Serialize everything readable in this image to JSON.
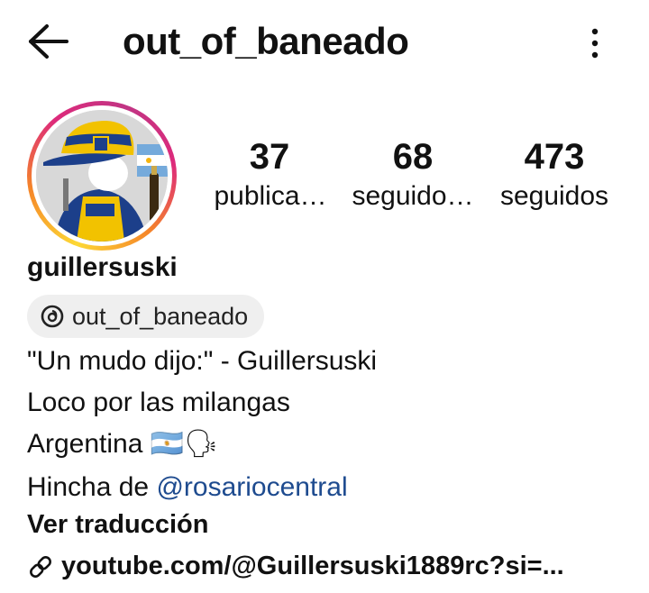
{
  "header": {
    "title": "out_of_baneado"
  },
  "stats": [
    {
      "value": "37",
      "label": "publica…"
    },
    {
      "value": "68",
      "label": "seguido…"
    },
    {
      "value": "473",
      "label": "seguidos"
    }
  ],
  "profile": {
    "username": "guillersuski",
    "threads_handle": "out_of_baneado",
    "bio_line1": "\"Un mudo dijo:\" - Guillersuski",
    "bio_line2": "Loco por las milangas",
    "bio_line3": "Argentina 🇦🇷🗣",
    "bio_line4_prefix": "Hincha de ",
    "bio_line4_mention": "@rosariocentral",
    "translate": "Ver traducción",
    "link": "youtube.com/@Guillersuski1889rc?si=..."
  },
  "colors": {
    "mention": "#1e4b8f",
    "chip_bg": "#efefef"
  }
}
